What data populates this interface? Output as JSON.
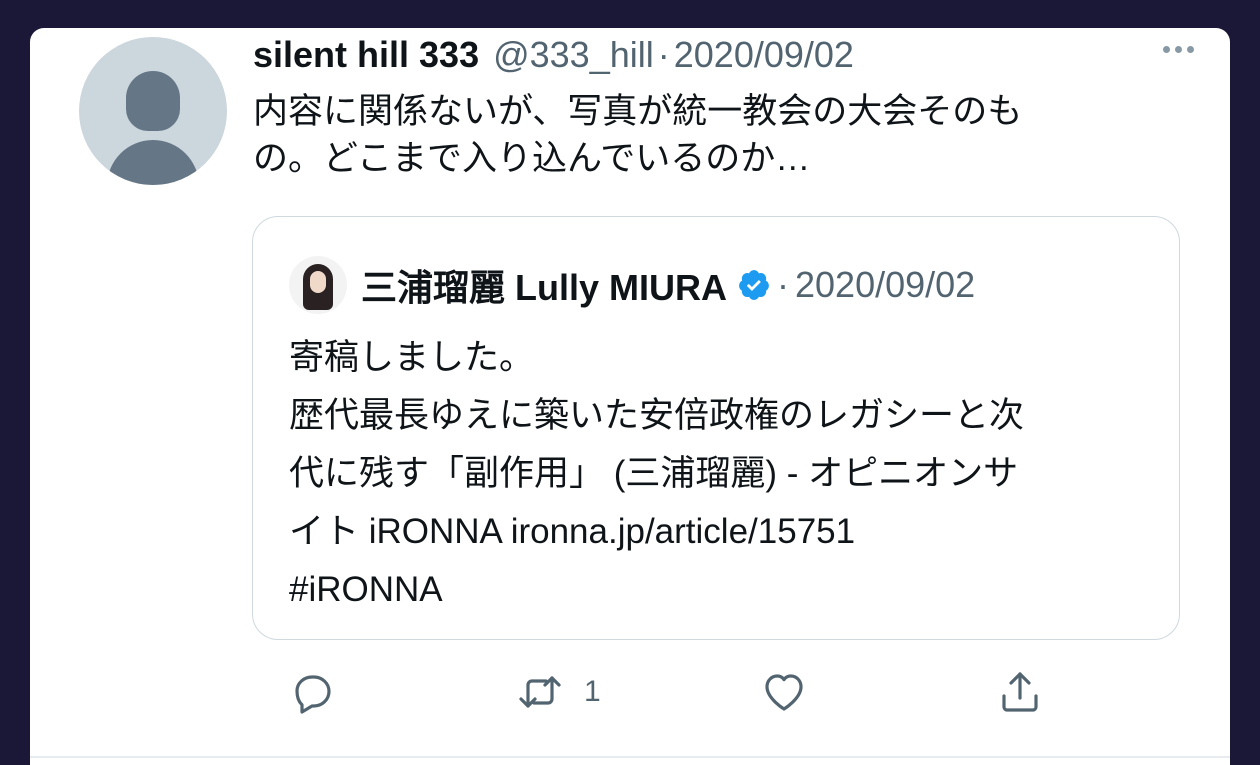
{
  "tweet": {
    "display_name": "silent hill 333",
    "handle": "@333_hill",
    "separator": "·",
    "date": "2020/09/02",
    "text": "内容に関係ないが、写真が統一教会の大会そのも\nの。どこまで入り込んでいるのか…",
    "avatar_icon": "default-avatar-icon",
    "more_icon": "more-options-icon"
  },
  "quote": {
    "display_name": "三浦瑠麗 Lully MIURA",
    "separator": "·",
    "date": "2020/09/02",
    "verified_icon": "verified-badge-icon",
    "text": "寄稿しました。\n歴代最長ゆえに築いた安倍政権のレガシーと次\n代に残す「副作用」 (三浦瑠麗) - オピニオンサ\nイト iRONNA ironna.jp/article/15751\n#iRONNA"
  },
  "actions": {
    "reply_icon": "reply-icon",
    "retweet_icon": "retweet-icon",
    "retweet_count": "1",
    "like_icon": "like-heart-icon",
    "share_icon": "share-icon"
  },
  "colors": {
    "background": "#1a1836",
    "card": "#ffffff",
    "primary_text": "#0f1419",
    "secondary_text": "#536471",
    "verified": "#1d9bf0"
  }
}
